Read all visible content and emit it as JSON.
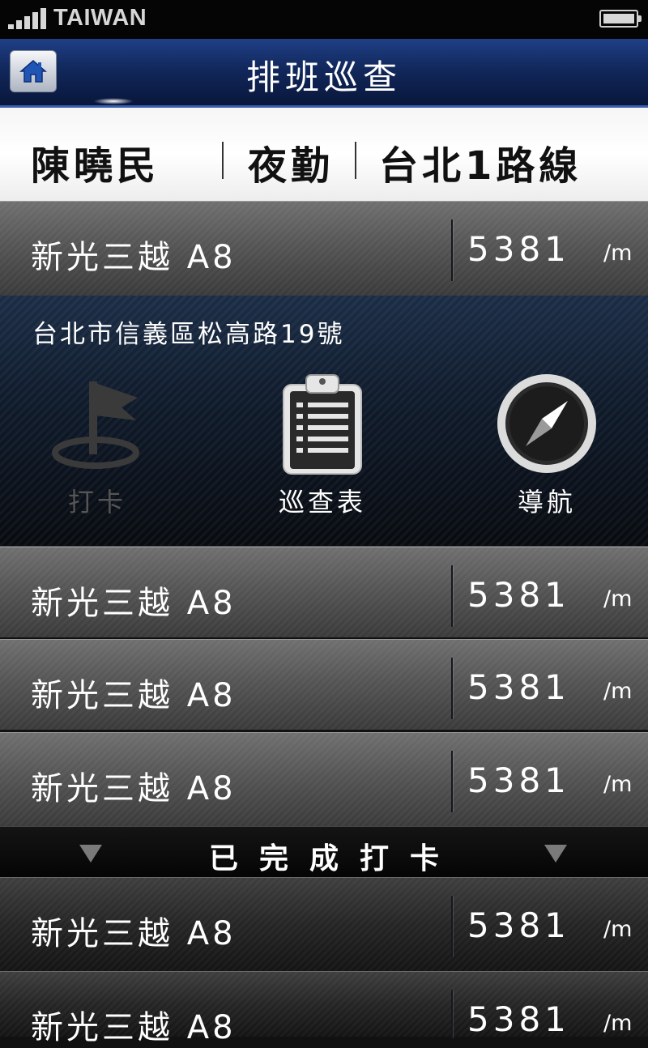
{
  "status_bar": {
    "carrier": "TAIWAN",
    "signal_icon": "signal-bars-icon",
    "battery_icon": "battery-full-icon"
  },
  "header": {
    "title": "排班巡查",
    "home_icon": "home-icon"
  },
  "info": {
    "name": "陳曉民",
    "shift": "夜勤",
    "route": "台北1路線"
  },
  "pending": [
    {
      "name": "新光三越 A8",
      "distance": "5381",
      "unit": "/m",
      "expanded": true
    },
    {
      "name": "新光三越 A8",
      "distance": "5381",
      "unit": "/m"
    },
    {
      "name": "新光三越 A8",
      "distance": "5381",
      "unit": "/m"
    },
    {
      "name": "新光三越 A8",
      "distance": "5381",
      "unit": "/m"
    }
  ],
  "detail": {
    "address": "台北市信義區松高路19號",
    "actions": [
      {
        "label": "打卡",
        "icon": "checkin-flag-icon",
        "enabled": false
      },
      {
        "label": "巡查表",
        "icon": "clipboard-icon",
        "enabled": true
      },
      {
        "label": "導航",
        "icon": "compass-icon",
        "enabled": true
      }
    ]
  },
  "completed_section": {
    "label": "已完成打卡",
    "marker_icon": "triangle-down-icon"
  },
  "completed": [
    {
      "name": "新光三越 A8",
      "distance": "5381",
      "unit": "/m"
    },
    {
      "name": "新光三越 A8",
      "distance": "5381",
      "unit": "/m"
    }
  ],
  "colors": {
    "title_bar": "#12285c",
    "accent_border": "#3a5fae",
    "row_gray": "#555555",
    "row_dark": "#252525"
  }
}
